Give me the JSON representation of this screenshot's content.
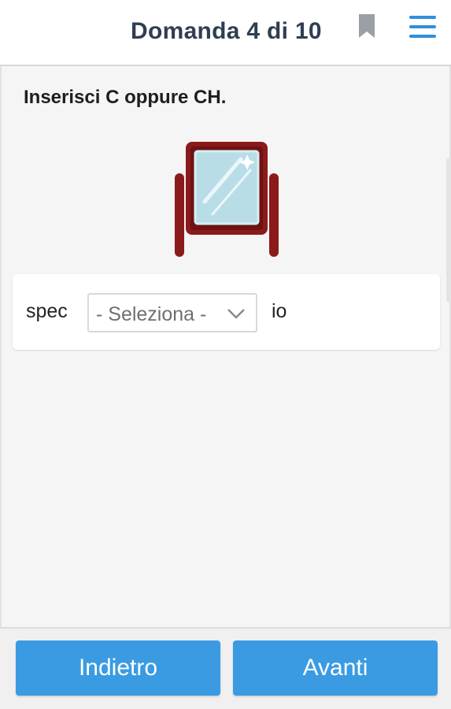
{
  "header": {
    "title": "Domanda 4 di 10",
    "bookmark_icon": "bookmark-icon",
    "menu_icon": "hamburger-menu-icon"
  },
  "question": {
    "instruction": "Inserisci C oppure CH.",
    "image_icon": "mirror-icon",
    "prefix": "spec",
    "select_placeholder": "- Seleziona -",
    "suffix": "io"
  },
  "footer": {
    "back_label": "Indietro",
    "next_label": "Avanti"
  },
  "colors": {
    "accent": "#3a9be2",
    "title": "#2f3e52",
    "bookmark": "#9aa0a6",
    "mirror_frame": "#8b1a1a"
  }
}
